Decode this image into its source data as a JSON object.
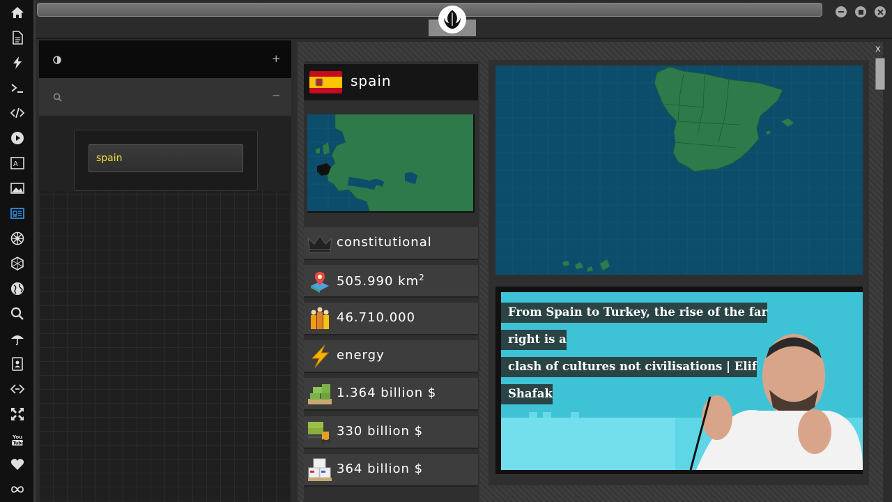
{
  "sidebar_icons": [
    "home-icon",
    "document-icon",
    "lightning-icon",
    "terminal-icon",
    "code-icon",
    "play-icon",
    "translate-icon",
    "image-icon",
    "news-icon",
    "empire-icon",
    "hexagon-icon",
    "globe-icon",
    "search-icon",
    "umbrella-icon",
    "contacts-icon",
    "link-icon",
    "fullscreen-icon",
    "youtube-icon",
    "heart-icon",
    "infinity-icon"
  ],
  "left_panel": {
    "row1_left_icon": "contrast-icon",
    "row1_right": "+",
    "row2_left_icon": "search-icon",
    "row2_right": "−",
    "search_value": "spain"
  },
  "country": {
    "name": "spain",
    "government": "constitutional",
    "area": "505.990 km",
    "area_sup": "2",
    "population": "46.710.000",
    "sector": "energy",
    "gdp": "1.364 billion $",
    "imports": "330 billion $",
    "exports": "364 billion $"
  },
  "news": {
    "line1": "From Spain to Turkey, the rise of the far right is a",
    "line2": "clash of cultures not civilisations | Elif Shafak"
  },
  "panel_close": "x",
  "colors": {
    "accent_yellow": "#f0e040",
    "map_sea": "#0d4d6c",
    "map_land": "#2e7a4a"
  }
}
